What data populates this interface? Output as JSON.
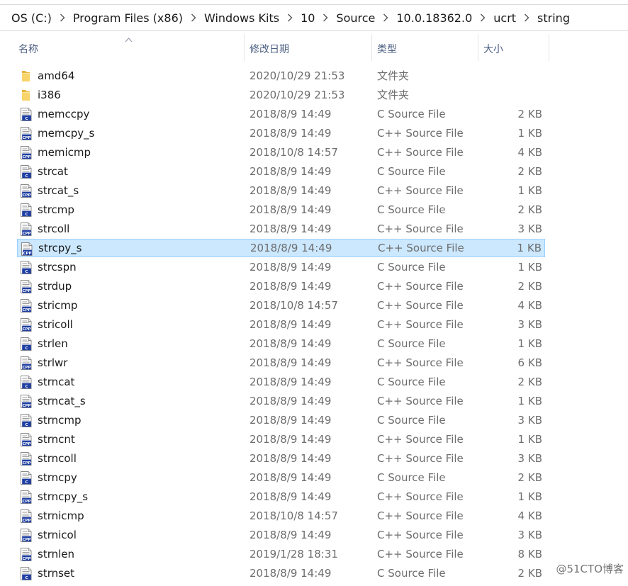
{
  "breadcrumb": [
    "OS (C:)",
    "Program Files (x86)",
    "Windows Kits",
    "10",
    "Source",
    "10.0.18362.0",
    "ucrt",
    "string"
  ],
  "columns": {
    "name": "名称",
    "date": "修改日期",
    "type": "类型",
    "size": "大小"
  },
  "sort_indicator": "chevron-up-icon",
  "colors": {
    "selection_bg": "#cce8ff",
    "selection_border": "#99d1ff",
    "folder": "#f4c44d",
    "source_icon_blue": "#1f3fa3"
  },
  "files": [
    {
      "name": "amd64",
      "date": "2020/10/29 21:53",
      "type": "文件夹",
      "size": "",
      "icon": "folder-icon"
    },
    {
      "name": "i386",
      "date": "2020/10/29 21:53",
      "type": "文件夹",
      "size": "",
      "icon": "folder-icon"
    },
    {
      "name": "memccpy",
      "date": "2018/8/9 14:49",
      "type": "C Source File",
      "size": "2 KB",
      "icon": "c-source-file-icon"
    },
    {
      "name": "memcpy_s",
      "date": "2018/8/9 14:49",
      "type": "C++ Source File",
      "size": "1 KB",
      "icon": "cpp-source-file-icon"
    },
    {
      "name": "memicmp",
      "date": "2018/10/8 14:57",
      "type": "C++ Source File",
      "size": "4 KB",
      "icon": "cpp-source-file-icon"
    },
    {
      "name": "strcat",
      "date": "2018/8/9 14:49",
      "type": "C Source File",
      "size": "2 KB",
      "icon": "c-source-file-icon"
    },
    {
      "name": "strcat_s",
      "date": "2018/8/9 14:49",
      "type": "C++ Source File",
      "size": "1 KB",
      "icon": "cpp-source-file-icon"
    },
    {
      "name": "strcmp",
      "date": "2018/8/9 14:49",
      "type": "C Source File",
      "size": "2 KB",
      "icon": "c-source-file-icon"
    },
    {
      "name": "strcoll",
      "date": "2018/8/9 14:49",
      "type": "C++ Source File",
      "size": "3 KB",
      "icon": "cpp-source-file-icon"
    },
    {
      "name": "strcpy_s",
      "date": "2018/8/9 14:49",
      "type": "C++ Source File",
      "size": "1 KB",
      "icon": "cpp-source-file-icon",
      "selected": true
    },
    {
      "name": "strcspn",
      "date": "2018/8/9 14:49",
      "type": "C Source File",
      "size": "1 KB",
      "icon": "c-source-file-icon"
    },
    {
      "name": "strdup",
      "date": "2018/8/9 14:49",
      "type": "C++ Source File",
      "size": "2 KB",
      "icon": "cpp-source-file-icon"
    },
    {
      "name": "stricmp",
      "date": "2018/10/8 14:57",
      "type": "C++ Source File",
      "size": "4 KB",
      "icon": "cpp-source-file-icon"
    },
    {
      "name": "stricoll",
      "date": "2018/8/9 14:49",
      "type": "C++ Source File",
      "size": "3 KB",
      "icon": "cpp-source-file-icon"
    },
    {
      "name": "strlen",
      "date": "2018/8/9 14:49",
      "type": "C Source File",
      "size": "1 KB",
      "icon": "c-source-file-icon"
    },
    {
      "name": "strlwr",
      "date": "2018/8/9 14:49",
      "type": "C++ Source File",
      "size": "6 KB",
      "icon": "cpp-source-file-icon"
    },
    {
      "name": "strncat",
      "date": "2018/8/9 14:49",
      "type": "C Source File",
      "size": "2 KB",
      "icon": "c-source-file-icon"
    },
    {
      "name": "strncat_s",
      "date": "2018/8/9 14:49",
      "type": "C++ Source File",
      "size": "1 KB",
      "icon": "cpp-source-file-icon"
    },
    {
      "name": "strncmp",
      "date": "2018/8/9 14:49",
      "type": "C Source File",
      "size": "3 KB",
      "icon": "c-source-file-icon"
    },
    {
      "name": "strncnt",
      "date": "2018/8/9 14:49",
      "type": "C++ Source File",
      "size": "1 KB",
      "icon": "cpp-source-file-icon"
    },
    {
      "name": "strncoll",
      "date": "2018/8/9 14:49",
      "type": "C++ Source File",
      "size": "3 KB",
      "icon": "cpp-source-file-icon"
    },
    {
      "name": "strncpy",
      "date": "2018/8/9 14:49",
      "type": "C Source File",
      "size": "2 KB",
      "icon": "c-source-file-icon"
    },
    {
      "name": "strncpy_s",
      "date": "2018/8/9 14:49",
      "type": "C++ Source File",
      "size": "1 KB",
      "icon": "cpp-source-file-icon"
    },
    {
      "name": "strnicmp",
      "date": "2018/10/8 14:57",
      "type": "C++ Source File",
      "size": "4 KB",
      "icon": "cpp-source-file-icon"
    },
    {
      "name": "strnicol",
      "date": "2018/8/9 14:49",
      "type": "C++ Source File",
      "size": "3 KB",
      "icon": "cpp-source-file-icon"
    },
    {
      "name": "strnlen",
      "date": "2019/1/28 18:31",
      "type": "C++ Source File",
      "size": "8 KB",
      "icon": "cpp-source-file-icon"
    },
    {
      "name": "strnset",
      "date": "2018/8/9 14:49",
      "type": "C Source File",
      "size": "2 KB",
      "icon": "c-source-file-icon"
    }
  ],
  "watermark": "@51CTO博客"
}
